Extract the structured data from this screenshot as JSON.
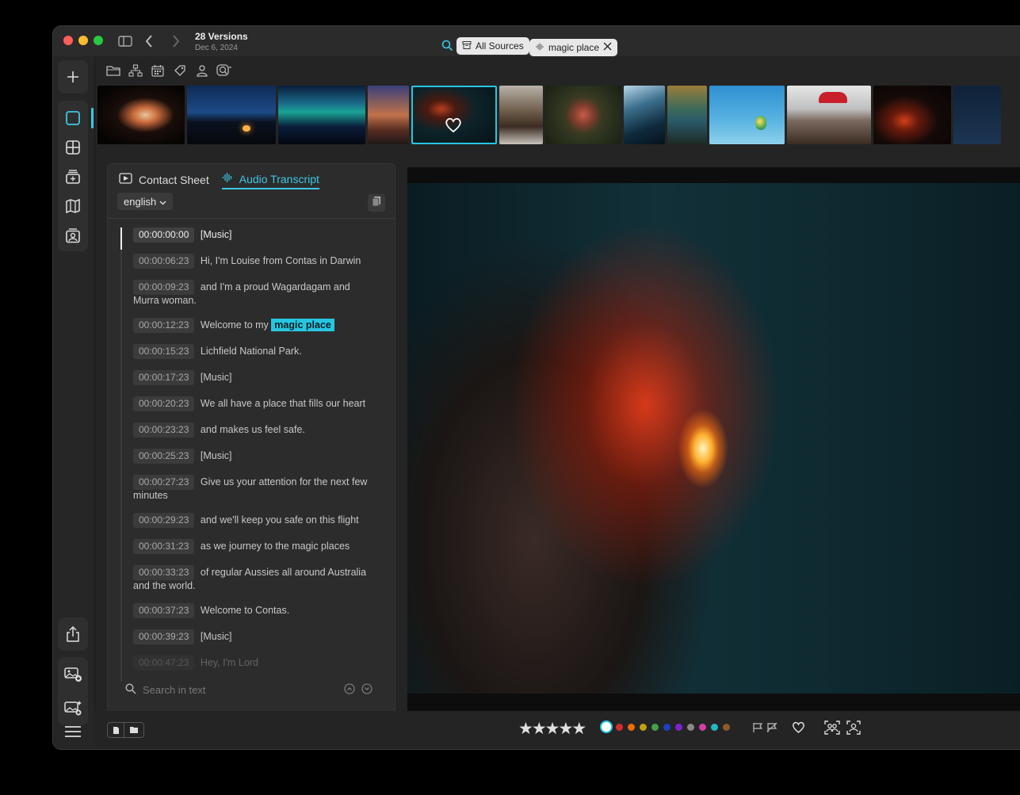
{
  "window": {
    "title": "28 Versions",
    "subtitle": "Dec 6, 2024"
  },
  "search": {
    "sources_label": "All Sources",
    "query_token": "magic place"
  },
  "panel": {
    "tabs": [
      {
        "label": "Contact Sheet",
        "active": false
      },
      {
        "label": "Audio Transcript",
        "active": true
      }
    ],
    "language": "english",
    "transcript": [
      {
        "time": "00:00:00:00",
        "text": "[Music]"
      },
      {
        "time": "00:00:06:23",
        "text": "Hi, I'm Louise from Contas in Darwin"
      },
      {
        "time": "00:00:09:23",
        "text": "and I'm a proud Wagardagam and Murra woman."
      },
      {
        "time": "00:00:12:23",
        "text": "Welcome to my",
        "highlight": "magic place"
      },
      {
        "time": "00:00:15:23",
        "text": "Lichfield National Park."
      },
      {
        "time": "00:00:17:23",
        "text": "[Music]"
      },
      {
        "time": "00:00:20:23",
        "text": "We all have a place that fills our heart"
      },
      {
        "time": "00:00:23:23",
        "text": "and makes us feel safe."
      },
      {
        "time": "00:00:25:23",
        "text": "[Music]"
      },
      {
        "time": "00:00:27:23",
        "text": "Give us your attention for the next few minutes"
      },
      {
        "time": "00:00:29:23",
        "text": "and we'll keep you safe on this flight"
      },
      {
        "time": "00:00:31:23",
        "text": "as we journey to the magic places"
      },
      {
        "time": "00:00:33:23",
        "text": "of regular Aussies all around Australia and the world."
      },
      {
        "time": "00:00:37:23",
        "text": "Welcome to Contas."
      },
      {
        "time": "00:00:39:23",
        "text": "[Music]"
      },
      {
        "time": "00:00:47:23",
        "text": "Hey, I'm Lord"
      }
    ],
    "search_placeholder": "Search in text"
  },
  "rating": {
    "stars": 5
  },
  "color_labels": [
    "#26c6e0",
    "#d32f2f",
    "#ef6c00",
    "#c0a010",
    "#43a047",
    "#1e40c0",
    "#7e22ce",
    "#8a8a8a",
    "#d33fa5",
    "#26b6c6",
    "#8a5a2a"
  ],
  "icons": {
    "sidebar": [
      "plus-icon",
      "single-view-icon",
      "grid-view-icon",
      "stack-add-icon",
      "map-icon",
      "face-album-icon",
      "share-icon",
      "add-photo-icon",
      "magic-photo-icon",
      "menu-icon"
    ],
    "toolbar": [
      "folder-icon",
      "hierarchy-icon",
      "calendar-icon",
      "tag-icon",
      "person-icon",
      "face-search-icon"
    ]
  }
}
